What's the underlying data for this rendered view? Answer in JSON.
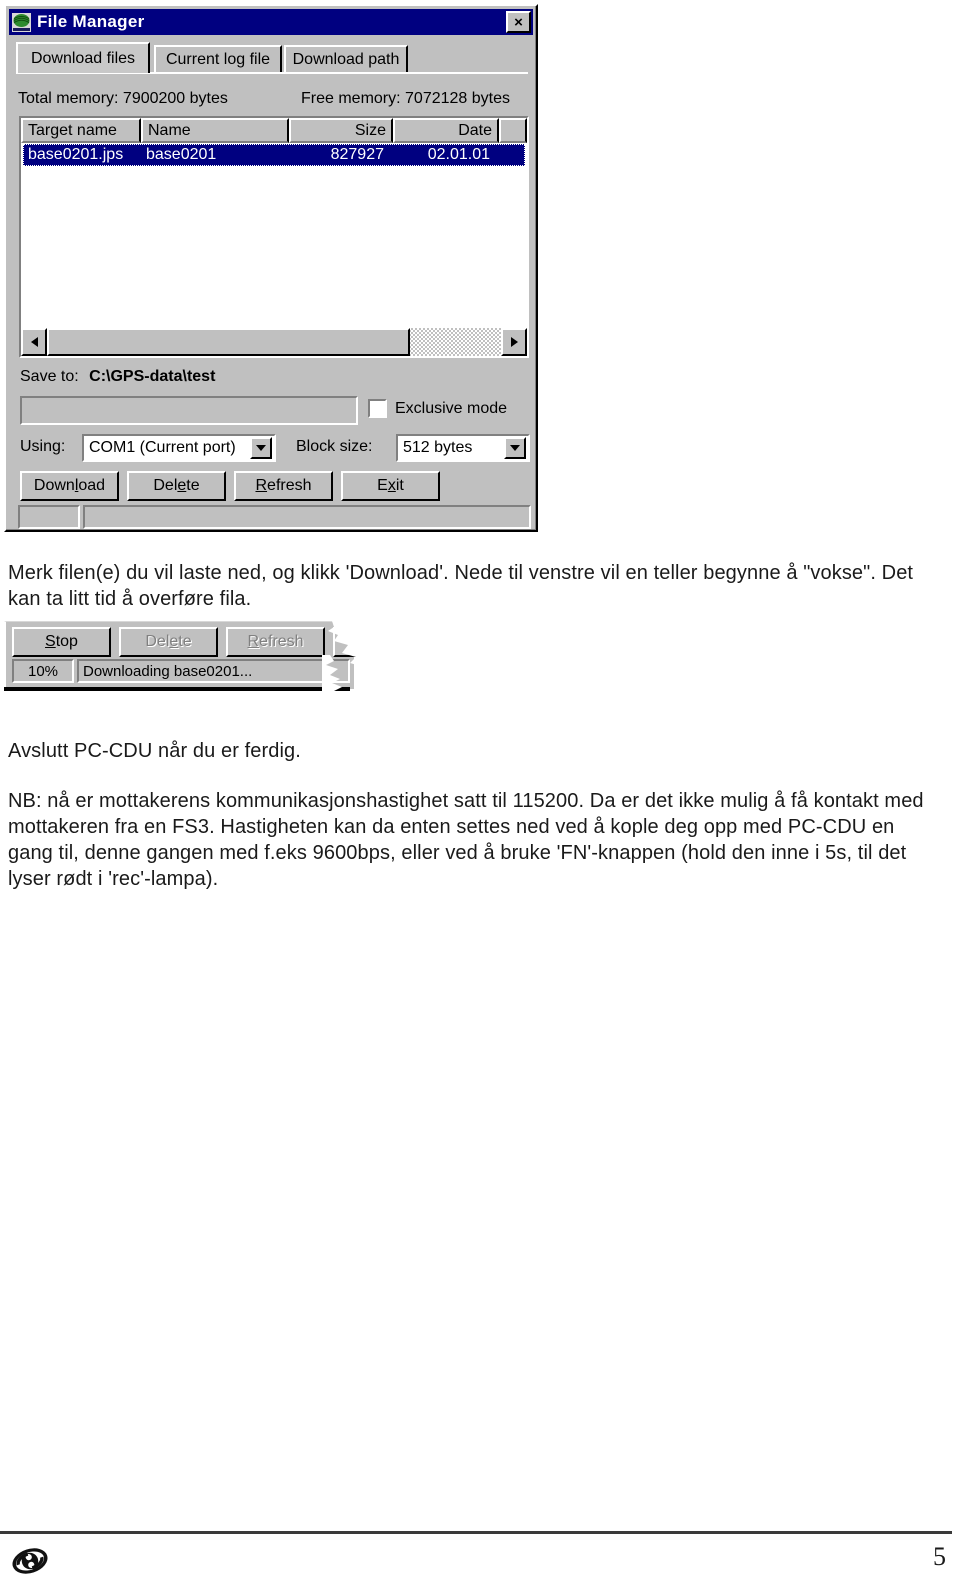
{
  "dialog": {
    "title": "File Manager",
    "icon": "app-logo-icon",
    "close_label": "×",
    "tabs": [
      {
        "label": "Download files",
        "active": true
      },
      {
        "label": "Current log file",
        "active": false
      },
      {
        "label": "Download path",
        "active": false
      }
    ],
    "memory": {
      "total": "Total memory: 7900200 bytes",
      "free": "Free memory: 7072128 bytes"
    },
    "filelist": {
      "columns": [
        "Target name",
        "Name",
        "Size",
        "Date"
      ],
      "rows": [
        {
          "target_name": "base0201.jps",
          "name": "base0201",
          "size": "827927",
          "date": "02.01.01",
          "selected": true
        }
      ]
    },
    "save_to": {
      "label": "Save to:",
      "path": "C:\\GPS-data\\test"
    },
    "path_field_value": "",
    "exclusive_mode": {
      "label": "Exclusive mode",
      "checked": false
    },
    "using": {
      "label": "Using:",
      "value": "COM1 (Current port)"
    },
    "block_size": {
      "label": "Block size:",
      "value": "512 bytes"
    },
    "buttons": [
      {
        "label": "Download",
        "accel": "l",
        "disabled": false
      },
      {
        "label": "Delete",
        "accel": "e",
        "disabled": false
      },
      {
        "label": "Refresh",
        "accel": "R",
        "disabled": false
      },
      {
        "label": "Exit",
        "accel": "x",
        "disabled": false
      }
    ],
    "status": {
      "percent": "",
      "message": ""
    }
  },
  "download_fragment": {
    "buttons": [
      {
        "label": "Stop",
        "accel": "S",
        "disabled": false
      },
      {
        "label": "Delete",
        "accel": "e",
        "disabled": true
      },
      {
        "label": "Refresh",
        "accel": "R",
        "disabled": true
      }
    ],
    "status": {
      "percent": "10%",
      "message": "Downloading base0201..."
    }
  },
  "document": {
    "paragraphs": {
      "intro": "Merk filen(e) du vil laste ned, og klikk 'Download'. Nede til venstre vil en teller begynne å \"vokse\". Det kan ta litt tid å overføre fila.",
      "avslutt": "Avslutt PC-CDU når du er ferdig.",
      "nb": "NB: nå er mottakerens kommunikasjonshastighet satt til 115200. Da er det ikke mulig å få kontakt med mottakeren fra en FS3. Hastigheten kan da enten settes ned ved å kople deg opp med PC-CDU en gang til, denne gangen med f.eks 9600bps, eller ved å bruke 'FN'-knappen (hold den inne i 5s, til det lyser rødt i 'rec'-lampa)."
    },
    "footer": {
      "page_number": "5",
      "logo": "company-swirl-logo"
    }
  },
  "colors": {
    "titlebar": "#000080",
    "dialog_face": "#c0c0c0",
    "selection": "#000080",
    "shadow": "#808080",
    "highlight": "#ffffff",
    "text": "#000000",
    "title_icon_green": "#2e8b2e"
  }
}
